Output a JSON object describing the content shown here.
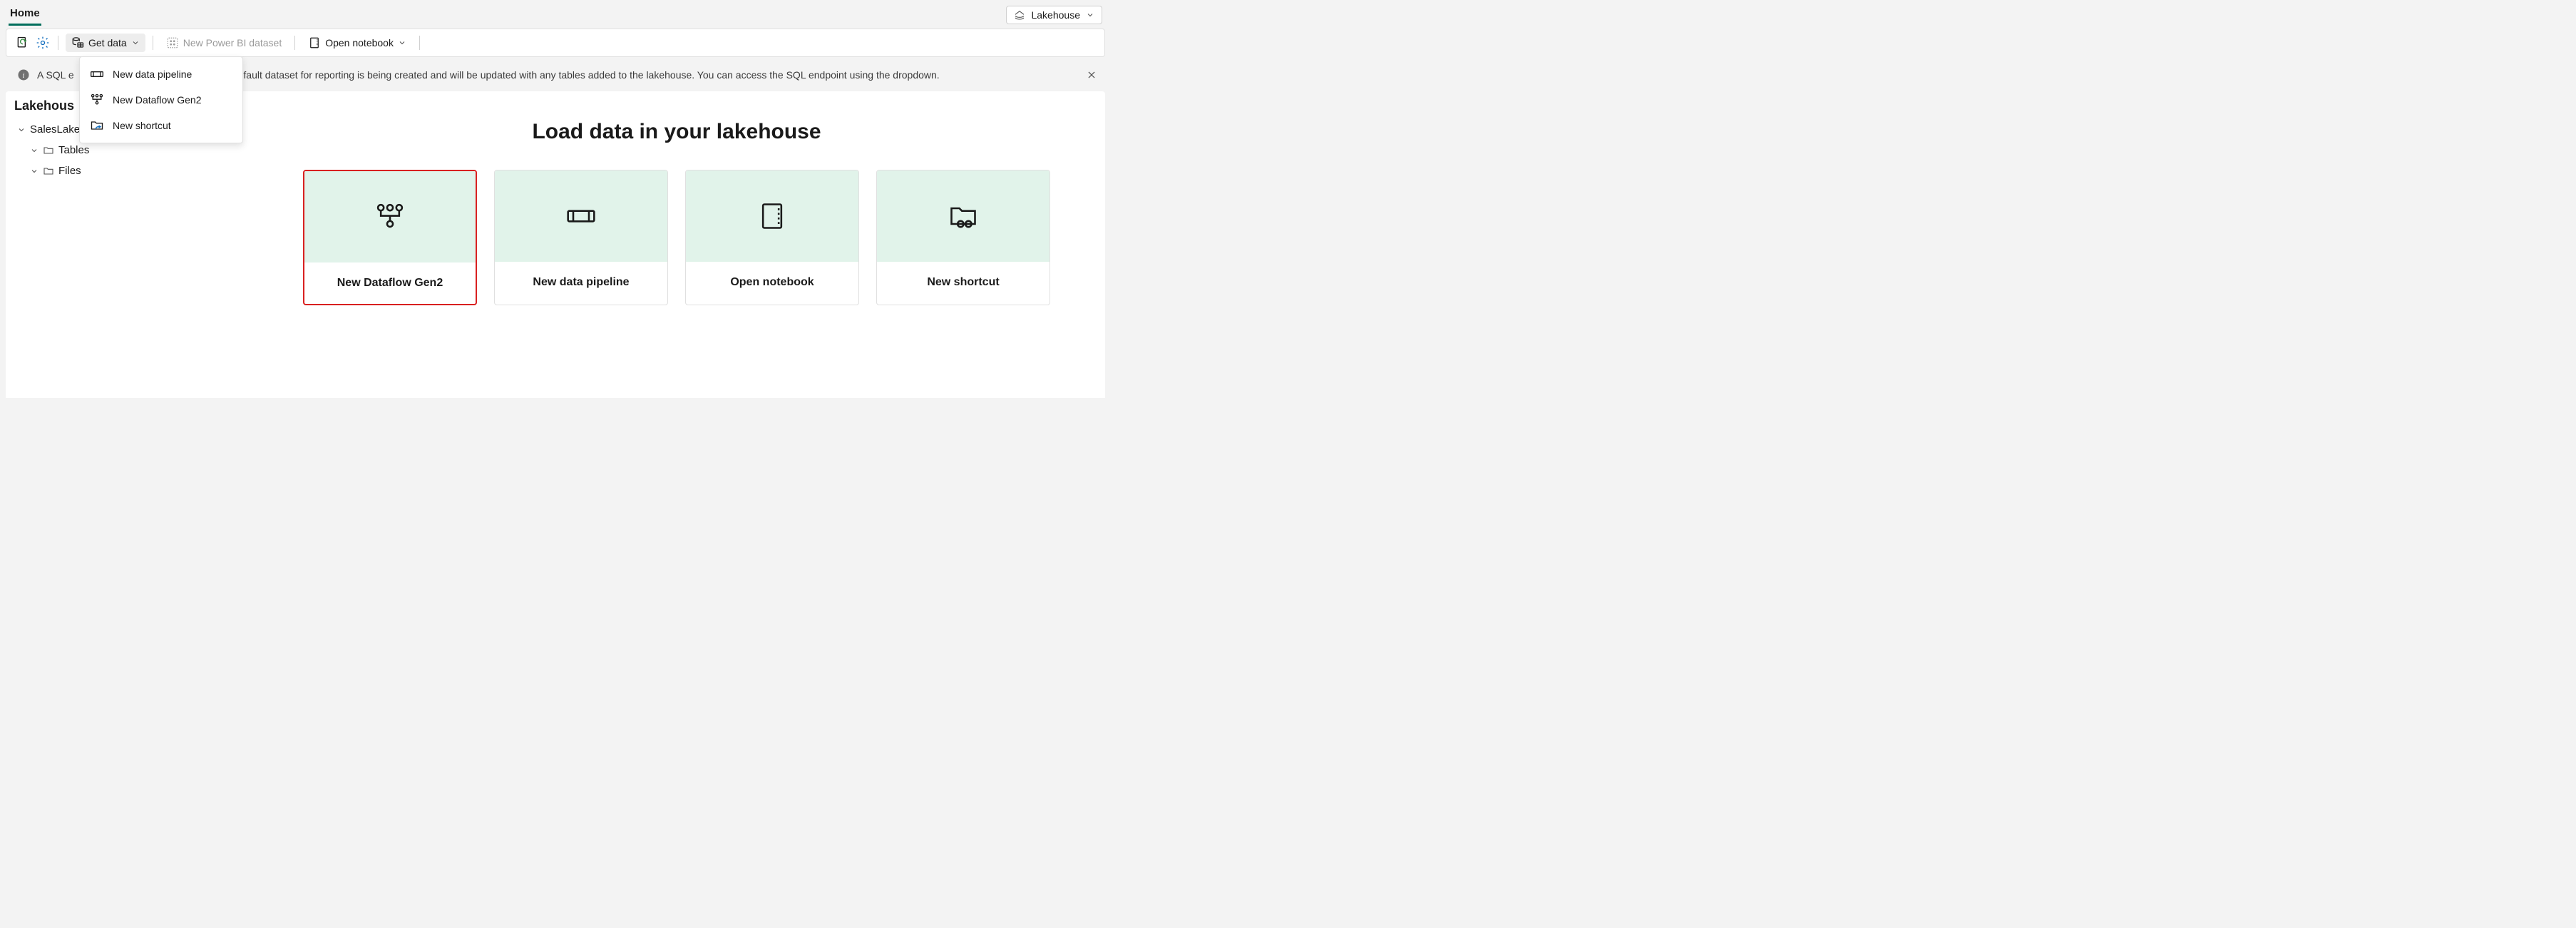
{
  "tabs": {
    "home": "Home"
  },
  "mode_switch": {
    "label": "Lakehouse"
  },
  "toolbar": {
    "get_data_label": "Get data",
    "new_dataset_label": "New Power BI dataset",
    "open_notebook_label": "Open notebook"
  },
  "get_data_menu": [
    {
      "label": "New data pipeline"
    },
    {
      "label": "New Dataflow Gen2"
    },
    {
      "label": "New shortcut"
    }
  ],
  "info_bar": {
    "prefix": "A SQL e",
    "rest": "efault dataset for reporting is being created and will be updated with any tables added to the lakehouse. You can access the SQL endpoint using the dropdown."
  },
  "sidebar": {
    "title": "Lakehous",
    "root": "SalesLakehouse",
    "nodes": [
      {
        "label": "Tables"
      },
      {
        "label": "Files"
      }
    ]
  },
  "main": {
    "heading": "Load data in your lakehouse",
    "cards": [
      {
        "label": "New Dataflow Gen2"
      },
      {
        "label": "New data pipeline"
      },
      {
        "label": "Open notebook"
      },
      {
        "label": "New shortcut"
      }
    ]
  }
}
